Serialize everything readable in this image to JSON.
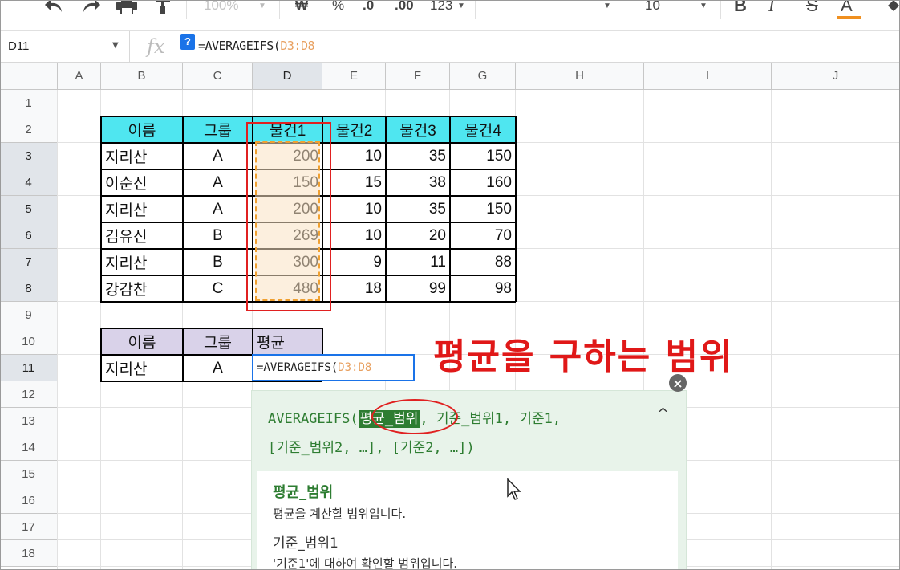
{
  "toolbar": {
    "zoom": "100%",
    "currency": "₩",
    "percent": "%",
    "dec_less": ".0",
    "dec_more": ".00",
    "format_more": "123",
    "font_size": "10",
    "bold": "B",
    "italic": "I",
    "strike": "S",
    "text_color": "A",
    "accent_color": "#f09020"
  },
  "formula_bar": {
    "cell_ref": "D11",
    "help": "?",
    "formula_prefix": "=AVERAGEIFS(",
    "formula_ref": "D3:D8"
  },
  "columns": [
    "A",
    "B",
    "C",
    "D",
    "E",
    "F",
    "G",
    "H",
    "I",
    "J"
  ],
  "rows": [
    "1",
    "2",
    "3",
    "4",
    "5",
    "6",
    "7",
    "8",
    "9",
    "10",
    "11",
    "12",
    "13",
    "14",
    "15",
    "16",
    "17",
    "18"
  ],
  "table1": {
    "headers": [
      "이름",
      "그룹",
      "물건1",
      "물건2",
      "물건3",
      "물건4"
    ],
    "rows": [
      [
        "지리산",
        "A",
        "200",
        "10",
        "35",
        "150"
      ],
      [
        "이순신",
        "A",
        "150",
        "15",
        "38",
        "160"
      ],
      [
        "지리산",
        "A",
        "200",
        "10",
        "35",
        "150"
      ],
      [
        "김유신",
        "B",
        "269",
        "10",
        "20",
        "70"
      ],
      [
        "지리산",
        "B",
        "300",
        "9",
        "11",
        "88"
      ],
      [
        "강감찬",
        "C",
        "480",
        "18",
        "99",
        "98"
      ]
    ],
    "header_color": "#4fe6f0"
  },
  "table2": {
    "headers": [
      "이름",
      "그룹",
      "평균"
    ],
    "row": [
      "지리산",
      "A"
    ],
    "header_color": "#d9d2e9"
  },
  "edit_cell": {
    "prefix": "=AVERAGEIFS(",
    "ref": "D3:D8"
  },
  "annotation": "평균을 구하는 범위",
  "tooltip": {
    "close": "×",
    "sig_prefix": "AVERAGEIFS(",
    "sig_current_arg": "평균_범위",
    "sig_rest": ", 기준_범위1, 기준1,",
    "sig_line2": "[기준_범위2, …], [기준2, …])",
    "chevron": "^",
    "arg_name": "평균_범위",
    "arg_desc": "평균을 계산할 범위입니다.",
    "arg2_name": "기준_범위1",
    "arg2_desc": "'기준1'에 대하여 확인할 범위입니다."
  }
}
